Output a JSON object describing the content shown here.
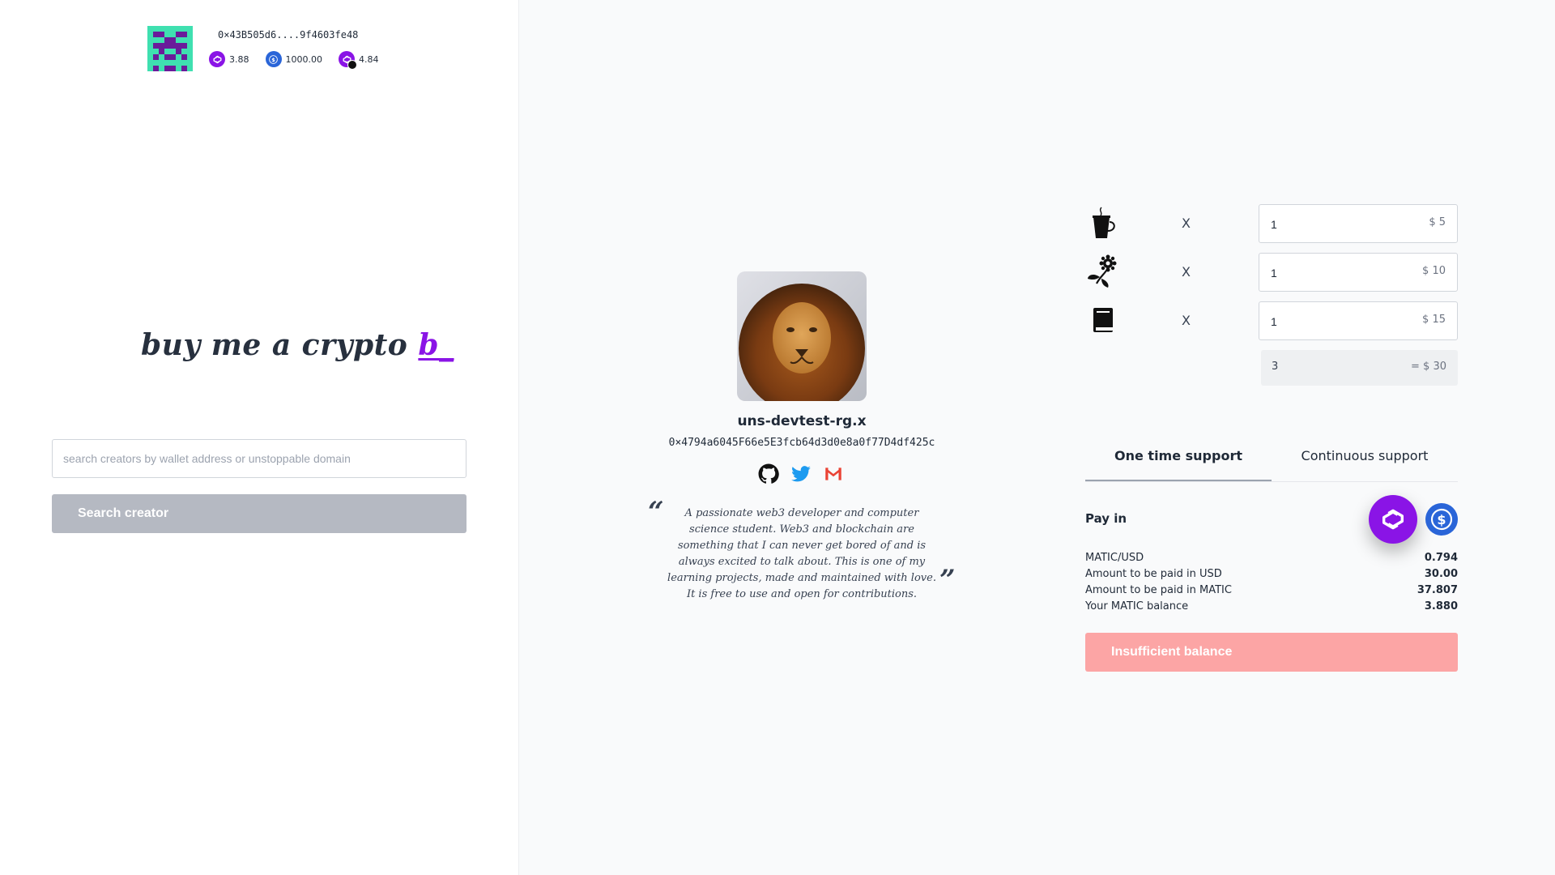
{
  "wallet": {
    "address": "0×43B505d6....9f4603fe48",
    "balances": [
      {
        "token": "MATIC",
        "icon": "polygon-icon",
        "amount": "3.88"
      },
      {
        "token": "USDC",
        "icon": "usdc-icon",
        "amount": "1000.00"
      },
      {
        "token": "WMATIC",
        "icon": "polygon-icon",
        "amount": "4.84"
      }
    ]
  },
  "logo": {
    "text": "buy me a crypto",
    "accent": "b_"
  },
  "search": {
    "placeholder": "search creators by wallet address or unstoppable domain",
    "value": "",
    "button_label": "Search creator"
  },
  "creator": {
    "name": "uns-devtest-rg.x",
    "address": "0×4794a6045F66e5E3fcb64d3d0e8a0f77D4df425c",
    "socials": [
      "github-icon",
      "twitter-icon",
      "gmail-icon"
    ],
    "bio": "A passionate web3 developer and computer science student. Web3 and blockchain are something that I can never get bored of and is always excited to talk about. This is one of my learning projects, made and maintained with love. It is free to use and open for contributions.",
    "quote_open": "“",
    "quote_close": "”"
  },
  "items": [
    {
      "icon": "coffee-icon",
      "x": "X",
      "qty": "1",
      "price": "$ 5"
    },
    {
      "icon": "flower-icon",
      "x": "X",
      "qty": "1",
      "price": "$ 10"
    },
    {
      "icon": "book-icon",
      "x": "X",
      "qty": "1",
      "price": "$ 15"
    }
  ],
  "total": {
    "count": "3",
    "sum": "= $ 30"
  },
  "tabs": [
    {
      "label": "One time support",
      "active": true
    },
    {
      "label": "Continuous support",
      "active": false
    }
  ],
  "pay_in": {
    "label": "Pay in",
    "options": [
      "polygon-icon",
      "usdc-icon"
    ],
    "selected": "polygon-icon"
  },
  "summary": [
    {
      "label": "MATIC/USD",
      "value": "0.794"
    },
    {
      "label": "Amount to be paid in USD",
      "value": "30.00"
    },
    {
      "label": "Amount to be paid in MATIC",
      "value": "37.807"
    },
    {
      "label": "Your MATIC balance",
      "value": "3.880"
    }
  ],
  "action": {
    "label": "Insufficient balance"
  },
  "colors": {
    "accent": "#8a14e6",
    "usdc": "#2a65d8",
    "button_disabled": "#b5b9c2",
    "error": "#fca5a5"
  }
}
